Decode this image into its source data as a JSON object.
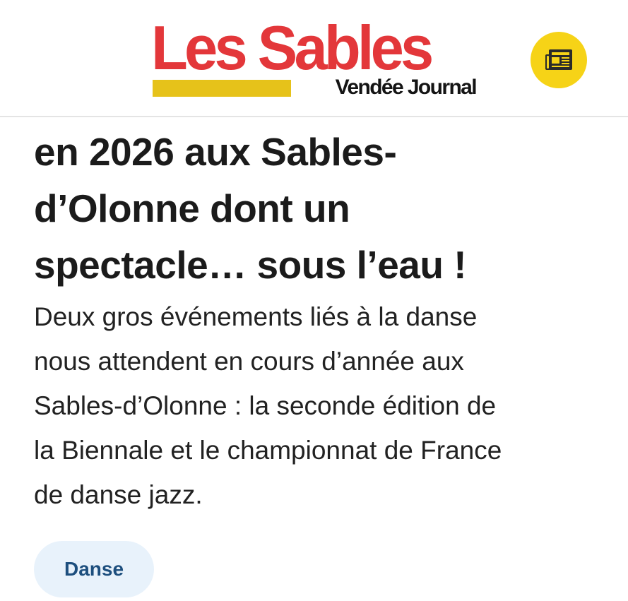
{
  "header": {
    "logo_main": "Les Sables",
    "logo_sub": "Vendée Journal",
    "news_button_icon": "newspaper-icon"
  },
  "article": {
    "headline": "en 2026 aux Sables-\nd’Olonne dont un\nspectacle… sous l’eau !",
    "lead": "Deux gros événements liés à la danse\nnous attendent en cours d’année aux\nSables-d’Olonne : la seconde édition de\nla Biennale et le championnat de France\nde danse jazz.",
    "tag": "Danse"
  },
  "colors": {
    "brand_red": "#e3373a",
    "brand_yellow": "#e6c21a",
    "news_button_bg": "#f6d317",
    "tag_bg": "#e8f2fb",
    "tag_text": "#1d4f7e",
    "header_border": "#e4e4e4"
  }
}
